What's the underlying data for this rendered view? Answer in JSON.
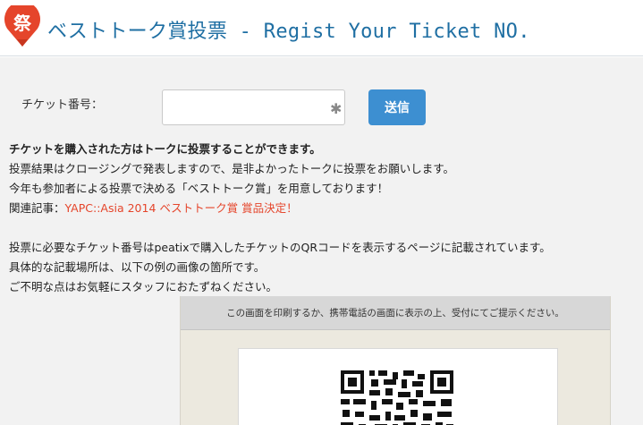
{
  "header": {
    "title": "ベストトーク賞投票 - Regist Your Ticket NO.",
    "logo": {
      "icon": "festival-fan-logo-icon",
      "glyph": "祭",
      "color": "#e5452b"
    }
  },
  "form": {
    "ticket_label": "チケット番号：",
    "ticket_value": "",
    "required_mark": "✱",
    "submit_label": "送信"
  },
  "info": {
    "lead": "チケットを購入された方はトークに投票することができます。",
    "line2": "投票結果はクロージングで発表しますので、是非よかったトークに投票をお願いします。",
    "line3": "今年も参加者による投票で決める「ベストトーク賞」を用意しております！",
    "related_prefix": "関連記事：",
    "related_link": "YAPC::Asia 2014 ベストトーク賞 賞品決定！",
    "line5": "投票に必要なチケット番号はpeatixで購入したチケットのQRコードを表示するページに記載されています。",
    "line6": "具体的な記載場所は、以下の例の画像の箇所です。",
    "line7": "ご不明な点はお気軽にスタッフにおたずねください。"
  },
  "sample": {
    "banner_text": "この画面を印刷するか、携帯電話の画面に表示の上、受付にてご提示ください。",
    "qr_icon": "qr-code-icon"
  },
  "colors": {
    "brand": "#1f6fa3",
    "button": "#3d8fd1",
    "link": "#e5452b",
    "background": "#f2f2f2"
  }
}
